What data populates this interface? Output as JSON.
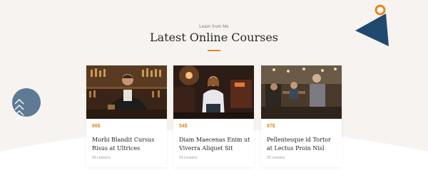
{
  "header": {
    "kicker": "Learn from Me",
    "title": "Latest Online Courses"
  },
  "colors": {
    "accent": "#e08a1e",
    "navy": "#1f4a6e",
    "section_bg": "#f7f3f0"
  },
  "courses": [
    {
      "price": "98$",
      "title": "Morbi Blandit Cursus Risus at Ultrices",
      "lessons": "26 Lessons",
      "image": "bartender-photo"
    },
    {
      "price": "54$",
      "title": "Diam Maecenas Enim ut Viverra Aliquet Sit",
      "lessons": "14 Lessons",
      "image": "woman-portrait-photo"
    },
    {
      "price": "87$",
      "title": "Pellentesque id Tortor at Lectus Proin Nisl",
      "lessons": "23 Lessons",
      "image": "cafe-group-photo"
    }
  ]
}
